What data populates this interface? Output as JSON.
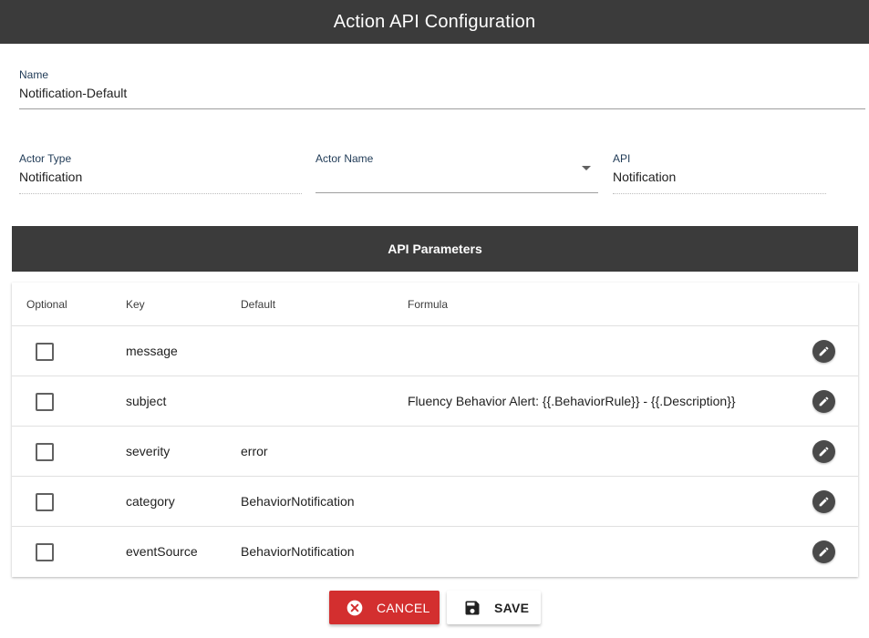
{
  "header": {
    "title": "Action API Configuration"
  },
  "form": {
    "name": {
      "label": "Name",
      "value": "Notification-Default"
    },
    "actor_type": {
      "label": "Actor Type",
      "value": "Notification"
    },
    "actor_name": {
      "label": "Actor Name",
      "value": ""
    },
    "api": {
      "label": "API",
      "value": "Notification"
    }
  },
  "params": {
    "title": "API Parameters",
    "columns": {
      "optional": "Optional",
      "key": "Key",
      "default": "Default",
      "formula": "Formula"
    },
    "rows": [
      {
        "key": "message",
        "default": "",
        "formula": "",
        "optional": false
      },
      {
        "key": "subject",
        "default": "",
        "formula": "Fluency Behavior Alert: {{.BehaviorRule}} - {{.Description}}",
        "optional": false
      },
      {
        "key": "severity",
        "default": "error",
        "formula": "",
        "optional": false
      },
      {
        "key": "category",
        "default": "BehaviorNotification",
        "formula": "",
        "optional": false
      },
      {
        "key": "eventSource",
        "default": "BehaviorNotification",
        "formula": "",
        "optional": false
      }
    ]
  },
  "actions": {
    "cancel": "CANCEL",
    "save": "SAVE"
  },
  "colors": {
    "header_bg": "#3b3b3b",
    "cancel_bg": "#d32f2f",
    "edit_icon_bg": "#4a4a4a"
  },
  "icons": {
    "edit": "pencil-icon",
    "cancel": "close-circle-icon",
    "save": "floppy-disk-icon",
    "dropdown": "caret-down-icon"
  }
}
